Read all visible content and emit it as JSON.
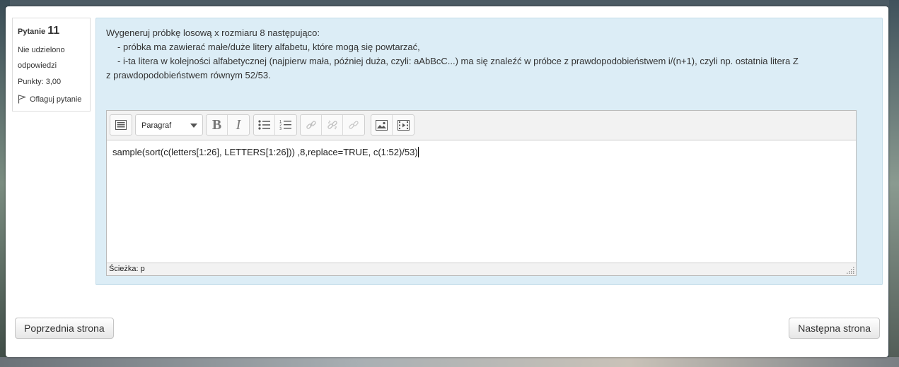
{
  "question_info": {
    "label": "Pytanie",
    "number": "11",
    "state": "Nie udzielono odpowiedzi",
    "grade": "Punkty: 3,00",
    "flag_label": "Oflaguj pytanie"
  },
  "question_text": {
    "intro": "Wygeneruj próbkę losową x rozmiaru 8 następująco:",
    "line1": "- próbka ma zawierać małe/duże litery alfabetu, które mogą się powtarzać,",
    "line2": "- i-ta litera w kolejności alfabetycznej (najpierw mała, później duża, czyli: aAbBcC...) ma się znaleźć w próbce z prawdopodobieństwem i/(n+1), czyli np. ostatnia litera Z",
    "line3": "z prawdopodobieństwem równym 52/53."
  },
  "editor": {
    "format_select": "Paragraf",
    "content": "sample(sort(c(letters[1:26], LETTERS[1:26])) ,8,replace=TRUE, c(1:52)/53)",
    "path_label": "Ścieżka:",
    "path_value": "p",
    "toolbar_icons": [
      "toolbar-toggle-icon",
      "bold-icon",
      "italic-icon",
      "unordered-list-icon",
      "ordered-list-icon",
      "link-icon",
      "unlink-icon",
      "manage-files-icon",
      "image-icon",
      "media-icon"
    ]
  },
  "navigation": {
    "prev_label": "Poprzednia strona",
    "next_label": "Następna strona"
  },
  "colors": {
    "content_bg": "#dcedf6",
    "page_bg": "#ffffff"
  }
}
